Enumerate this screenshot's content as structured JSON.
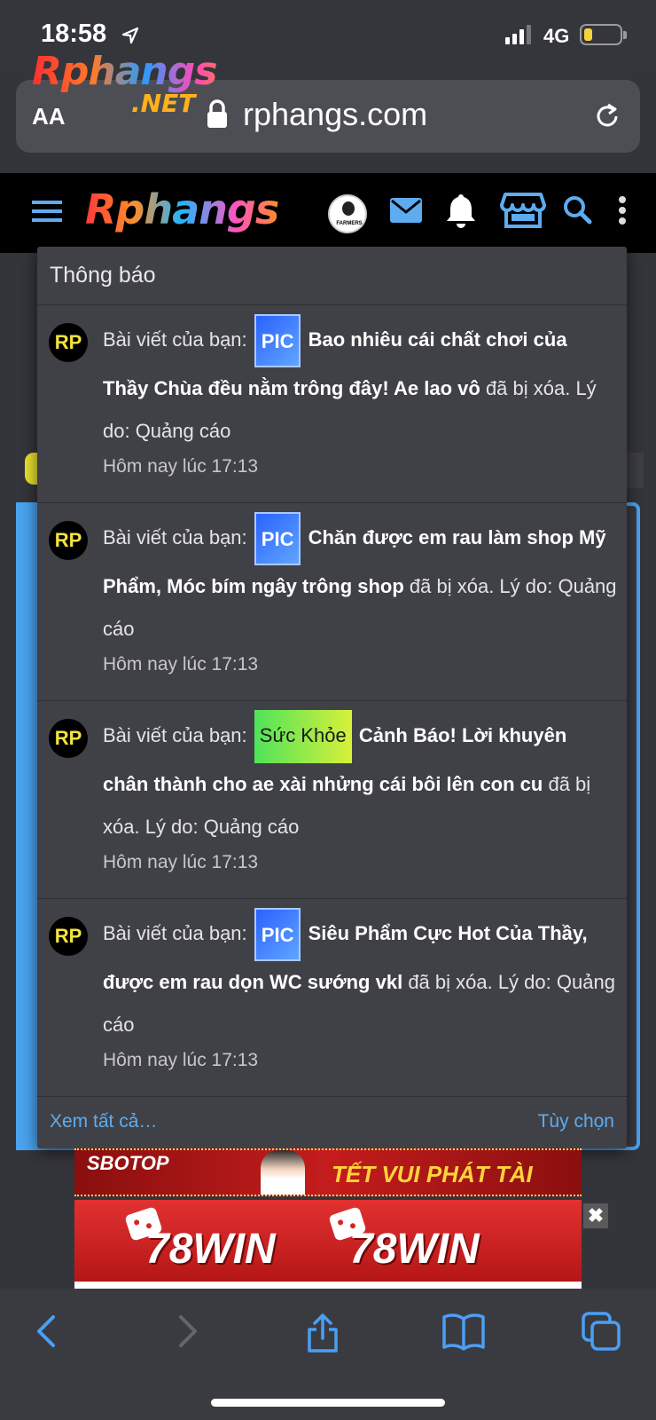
{
  "status_bar": {
    "time": "18:58",
    "network": "4G"
  },
  "url_bar": {
    "text_size_label": "AA",
    "url": "rphangs.com",
    "overlay_logo": "Rphangs",
    "overlay_logo_suffix": ".NET"
  },
  "site_header": {
    "logo": "Rphangs",
    "avatar_label": "FARMERS"
  },
  "notifications": {
    "title": "Thông báo",
    "items": [
      {
        "avatar": "RP",
        "prefix": "Bài viết của bạn:",
        "tag": "PIC",
        "post": "Bao nhiêu cái chất chơi của Thầy Chùa đều nằm trông đây! Ae lao vô",
        "suffix": "đã bị xóa. Lý do: Quảng cáo",
        "time": "Hôm nay lúc 17:13"
      },
      {
        "avatar": "RP",
        "prefix": "Bài viết của bạn:",
        "tag": "PIC",
        "post": "Chăn được em rau làm shop Mỹ Phẩm, Móc bím ngây trông shop",
        "suffix": "đã bị xóa. Lý do: Quảng cáo",
        "time": "Hôm nay lúc 17:13"
      },
      {
        "avatar": "RP",
        "prefix": "Bài viết của bạn:",
        "tag": "Sức Khỏe",
        "post": "Cảnh Báo! Lời khuyên chân thành cho ae xài nhửng cái bôi lên con cu",
        "suffix": "đã bị xóa. Lý do: Quảng cáo",
        "time": "Hôm nay lúc 17:13"
      },
      {
        "avatar": "RP",
        "prefix": "Bài viết của bạn:",
        "tag": "PIC",
        "post": "Siêu Phẩm Cực Hot Của Thầy, được em rau dọn WC sướng vkl",
        "suffix": "đã bị xóa. Lý do: Quảng cáo",
        "time": "Hôm nay lúc 17:13"
      }
    ],
    "see_all": "Xem tất cả…",
    "options": "Tùy chọn"
  },
  "ads": {
    "ad1_brand": "SBOTOP",
    "ad1_slogan": "TẾT VUI PHÁT TÀI",
    "ad2_brand_left": "78WIN",
    "ad2_brand_right": "78WIN",
    "close": "✖"
  },
  "colors": {
    "accent_blue": "#5eacf0",
    "tag_pic": "#2962ff",
    "tag_health": "#4fe35a",
    "avatar_text": "#f5e43a"
  }
}
